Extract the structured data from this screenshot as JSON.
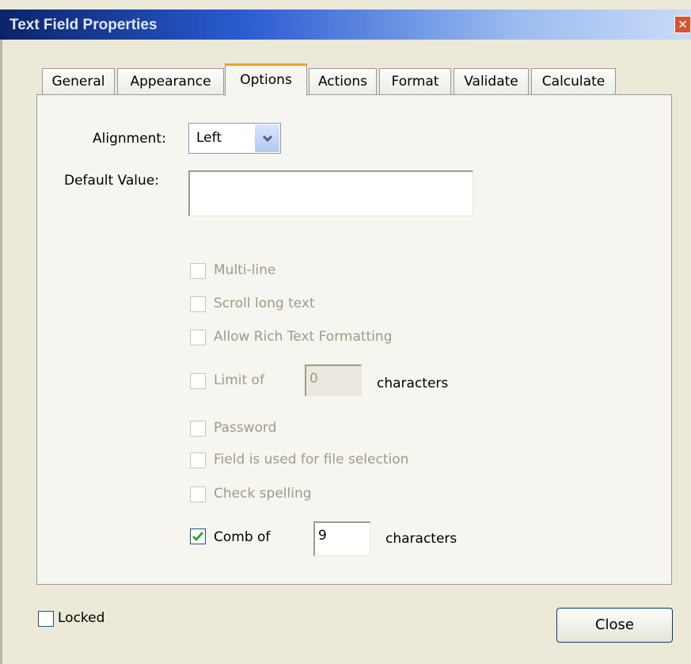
{
  "window": {
    "title": "Text Field Properties",
    "close_symbol": "✕"
  },
  "tabs": [
    {
      "label": "General"
    },
    {
      "label": "Appearance"
    },
    {
      "label": "Options",
      "active": true
    },
    {
      "label": "Actions"
    },
    {
      "label": "Format"
    },
    {
      "label": "Validate"
    },
    {
      "label": "Calculate"
    }
  ],
  "options": {
    "alignment": {
      "label": "Alignment:",
      "value": "Left",
      "icon": "chevron-down-icon"
    },
    "default_value": {
      "label": "Default Value:",
      "value": ""
    },
    "multi_line": {
      "label": "Multi-line",
      "checked": false,
      "enabled": false
    },
    "scroll_long_text": {
      "label": "Scroll long text",
      "checked": false,
      "enabled": false
    },
    "allow_rich_text": {
      "label": "Allow Rich Text Formatting",
      "checked": false,
      "enabled": false
    },
    "limit": {
      "label": "Limit of",
      "value": "0",
      "suffix": "characters",
      "checked": false,
      "enabled": false
    },
    "password": {
      "label": "Password",
      "checked": false,
      "enabled": false
    },
    "file_selection": {
      "label": "Field is used for file selection",
      "checked": false,
      "enabled": false
    },
    "check_spelling": {
      "label": "Check spelling",
      "checked": false,
      "enabled": false
    },
    "comb": {
      "label": "Comb of",
      "value": "9",
      "suffix": "characters",
      "checked": true,
      "enabled": true
    }
  },
  "footer": {
    "locked": {
      "label": "Locked",
      "checked": false
    },
    "close_label": "Close"
  },
  "colors": {
    "titlebar": "#2a5bd0",
    "active_tab_accent": "#f0a21e",
    "checkmark": "#21a121",
    "disabled_text": "#9e9b8c"
  }
}
